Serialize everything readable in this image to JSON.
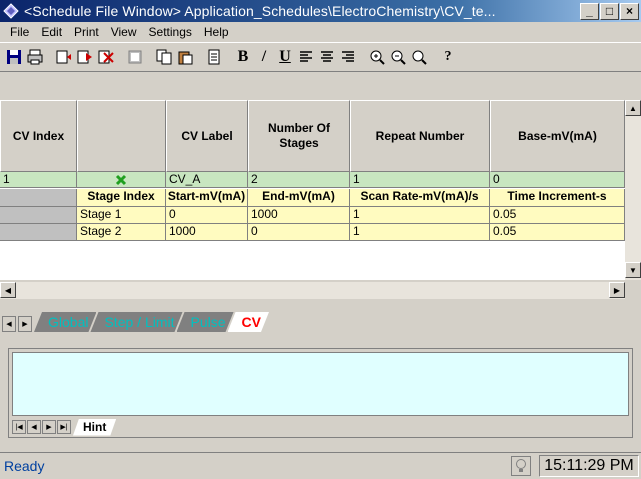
{
  "window": {
    "title": "<Schedule File Window> Application_Schedules\\ElectroChemistry\\CV_te...",
    "minimize": "_",
    "restore": "□",
    "close": "×"
  },
  "menu": [
    "File",
    "Edit",
    "Print",
    "View",
    "Settings",
    "Help"
  ],
  "toolbar": {
    "bold": "B",
    "italic": "/",
    "underline": "U",
    "help": "?"
  },
  "grid": {
    "headers": [
      "CV Index",
      "",
      "CV Label",
      "Number Of Stages",
      "Repeat Number",
      "Base-mV(mA)"
    ],
    "cv_row": {
      "index": "1",
      "label": "CV_A",
      "stages": "2",
      "repeat": "1",
      "base": "0"
    },
    "stage_headers": [
      "Stage Index",
      "Start-mV(mA)",
      "End-mV(mA)",
      "Scan Rate-mV(mA)/s",
      "Time Increment-s"
    ],
    "stages": [
      [
        "Stage 1",
        "0",
        "1000",
        "1",
        "0.05"
      ],
      [
        "Stage 2",
        "1000",
        "0",
        "1",
        "0.05"
      ]
    ]
  },
  "tabs": [
    {
      "label": "Global",
      "active": false
    },
    {
      "label": "Step / Limit",
      "active": false
    },
    {
      "label": "Pulse",
      "active": false
    },
    {
      "label": "CV",
      "active": true
    }
  ],
  "hint": {
    "tab_label": "Hint",
    "content": ""
  },
  "status": {
    "text": "Ready",
    "time": "15:11:29 PM"
  },
  "colors": {
    "title_bar": "#0a246a",
    "cv_row": "#c8e6c0",
    "stage_rows": "#fffbc0",
    "hint_box": "#e0ffff",
    "active_tab": "#ff0000",
    "inactive_tab_text": "#00c0c0",
    "status_text": "#0040a0"
  }
}
